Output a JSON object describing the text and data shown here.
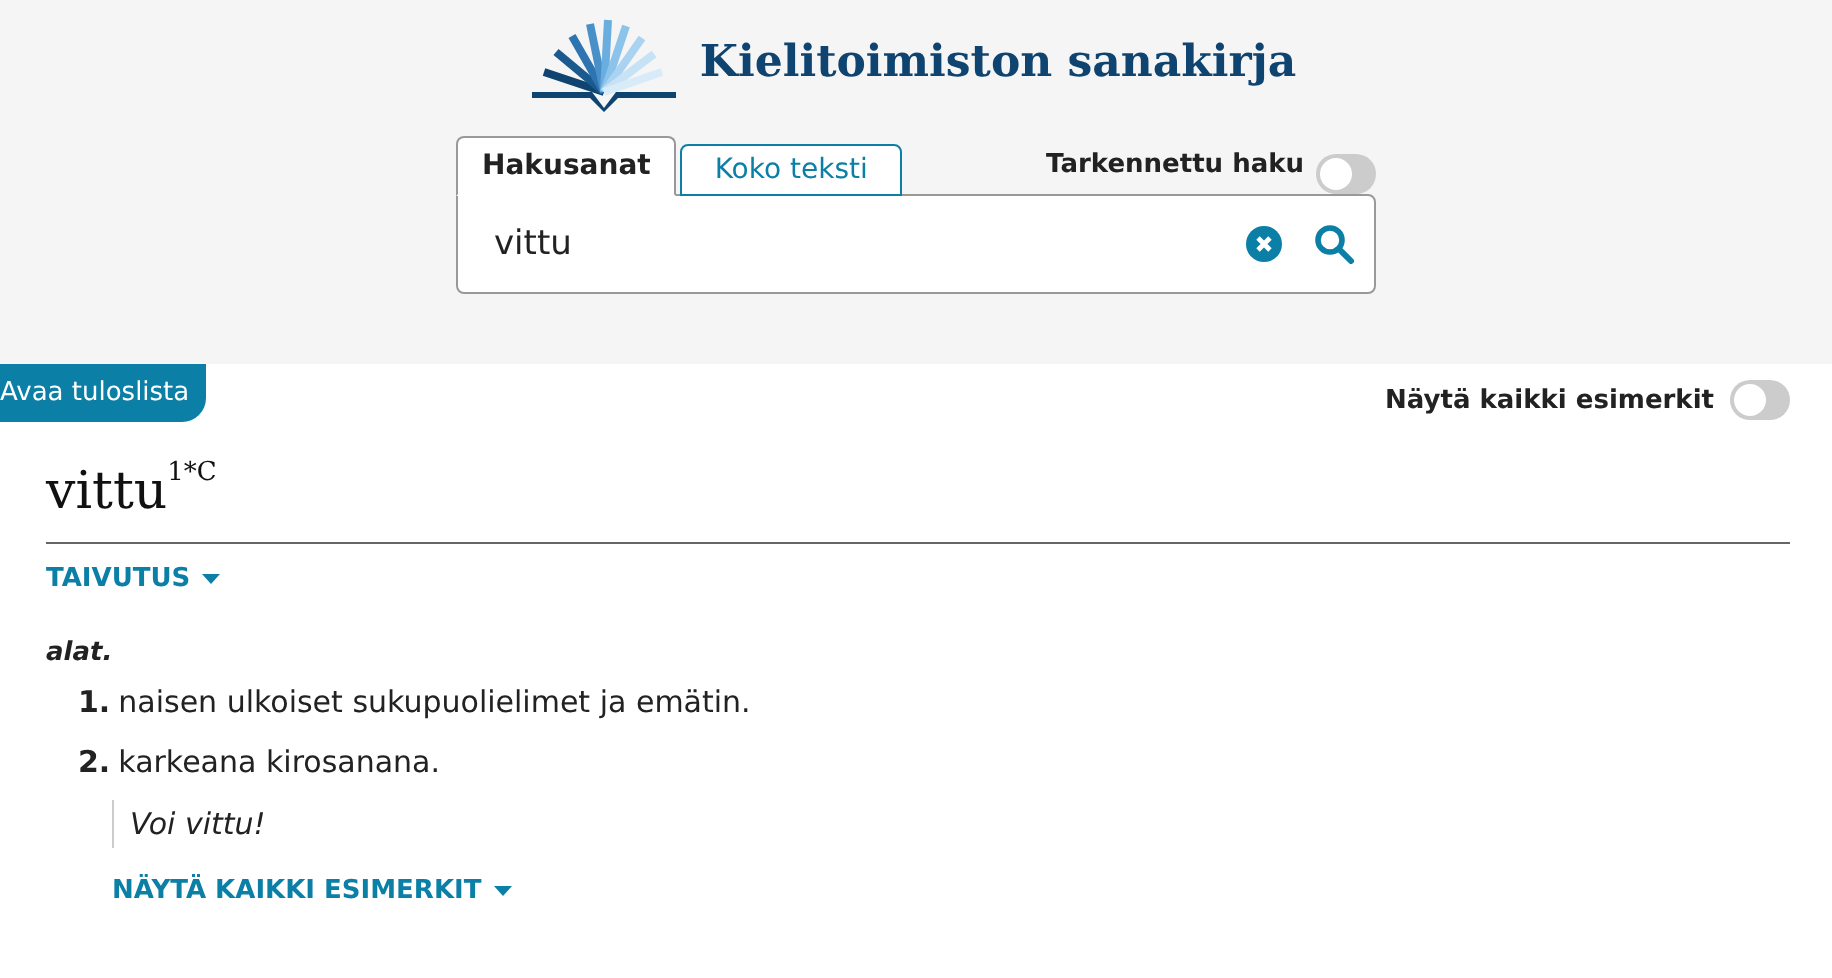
{
  "header": {
    "site_title": "Kielitoimiston sanakirja"
  },
  "search": {
    "tabs": [
      {
        "label": "Hakusanat",
        "selected": true
      },
      {
        "label": "Koko teksti",
        "selected": false
      }
    ],
    "advanced": {
      "label": "Tarkennettu haku",
      "on": false
    },
    "value": "vittu"
  },
  "toolbar": {
    "results_button": "Avaa tuloslista",
    "show_examples": {
      "label": "Näytä kaikki esimerkit",
      "on": false
    }
  },
  "entry": {
    "headword": "vittu$^{1*C}$",
    "inflection": "TAIVUTUS",
    "register": "alat.",
    "senses": [
      {
        "number": "1.",
        "text": "naisen ulkoiset sukupuolielimet ja emätin."
      },
      {
        "number": "2.",
        "text": "karkeana kirosanana.",
        "examples": [
          "Voi vittu!"
        ]
      }
    ],
    "show_all_examples": "NÄYTÄ KAIKKI ESIMERKIT"
  }
}
